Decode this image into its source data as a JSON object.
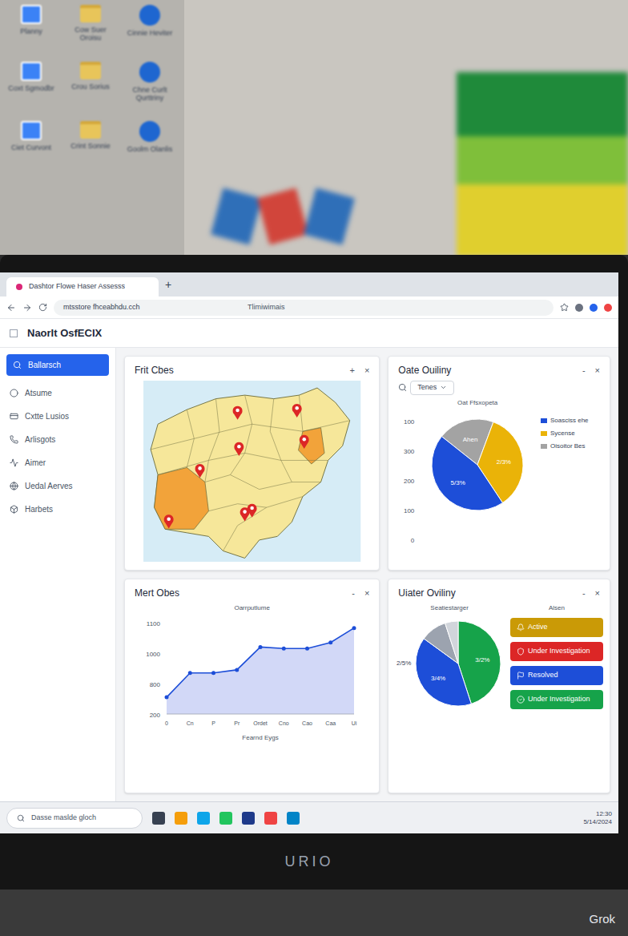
{
  "desktop": {
    "icons": [
      {
        "label": "Planny",
        "kind": "app"
      },
      {
        "label": "Cow Suer Oroisu",
        "kind": "folder"
      },
      {
        "label": "Cinnie Heviter",
        "kind": "shortcut"
      },
      {
        "label": "Coxt Sgmodbr",
        "kind": "app"
      },
      {
        "label": "Crou Sorius",
        "kind": "folder"
      },
      {
        "label": "Chne Curlt Qurttriny",
        "kind": "shortcut"
      },
      {
        "label": "Ciet Curvont",
        "kind": "app"
      },
      {
        "label": "Crint Sonnie",
        "kind": "folder"
      },
      {
        "label": "Goolm Olanlis",
        "kind": "shortcut"
      }
    ]
  },
  "browser": {
    "tab_title": "Dashtor Flowe Haser Assesss",
    "new_tab": "+",
    "address": "mtsstore fhceabhdu.cch",
    "page_title": "Tlimiwimais"
  },
  "app": {
    "title": "NaorIt OsfECIX"
  },
  "sidebar": {
    "items": [
      {
        "label": "Ballarsch",
        "selected": true
      },
      {
        "label": "Atsume",
        "selected": false
      },
      {
        "label": "Cxtte Lusios",
        "selected": false
      },
      {
        "label": "Arlisgots",
        "selected": false
      },
      {
        "label": "Aimer",
        "selected": false
      },
      {
        "label": "Uedal Aerves",
        "selected": false
      },
      {
        "label": "Harbets",
        "selected": false
      }
    ]
  },
  "map_card": {
    "title": "Frit Cbes",
    "controls": [
      "+",
      "×"
    ]
  },
  "quality_card": {
    "title": "Oate Ouiliny",
    "controls": [
      "-",
      "×"
    ],
    "filter": "Tenes",
    "chart_title": "Oat Ffsxopeta",
    "y_ticks": [
      "100",
      "300",
      "200",
      "100",
      "0"
    ],
    "legend": [
      {
        "label": "Soasciss ehe",
        "color": "#1d4ed8"
      },
      {
        "label": "Sycense",
        "color": "#eab308"
      },
      {
        "label": "Oisoitor Bes",
        "color": "#a3a3a3"
      }
    ],
    "slices": [
      {
        "value": 20,
        "label": "Ahen",
        "color": "#a3a3a3"
      },
      {
        "value": 35,
        "label": "2/3%",
        "color": "#eab308"
      },
      {
        "value": 45,
        "label": "5/3%",
        "color": "#1d4ed8"
      }
    ]
  },
  "trend_card": {
    "title": "Mert Obes",
    "controls": [
      "-",
      "×"
    ],
    "subtitle": "Oarrputlume",
    "y_ticks": [
      "1100",
      "1000",
      "800",
      "200"
    ],
    "x_labels": [
      "0",
      "Cn",
      "P",
      "Pr",
      "Ordet",
      "Cno",
      "Cao",
      "Caa",
      "Ui"
    ],
    "x_title": "Fearnd Eygs",
    "values": [
      220,
      540,
      540,
      580,
      880,
      860,
      860,
      940,
      1130
    ]
  },
  "status_card": {
    "title": "Uiater Oviliny",
    "controls": [
      "-",
      "×"
    ],
    "subtitle": "Seatiestarger",
    "side_label": "2/5%",
    "slices": [
      {
        "value": 45,
        "label": "3/2%",
        "color": "#16a34a"
      },
      {
        "value": 40,
        "label": "3/4%",
        "color": "#1d4ed8"
      },
      {
        "value": 10,
        "label": "",
        "color": "#9ca3af"
      },
      {
        "value": 5,
        "label": "",
        "color": "#d1d5db"
      }
    ],
    "status_title": "Alsen",
    "statuses": [
      {
        "label": "Active",
        "color": "#ca9a06"
      },
      {
        "label": "Under Investigation",
        "color": "#dc2626"
      },
      {
        "label": "Resolved",
        "color": "#1d4ed8"
      },
      {
        "label": "Under Investigation",
        "color": "#16a34a"
      }
    ]
  },
  "taskbar": {
    "search_placeholder": "Dasse maslde gloch",
    "clock": [
      "12:30",
      "5/14/2024"
    ]
  },
  "monitor": {
    "brand": "URIO"
  },
  "watermark": "Grok"
}
